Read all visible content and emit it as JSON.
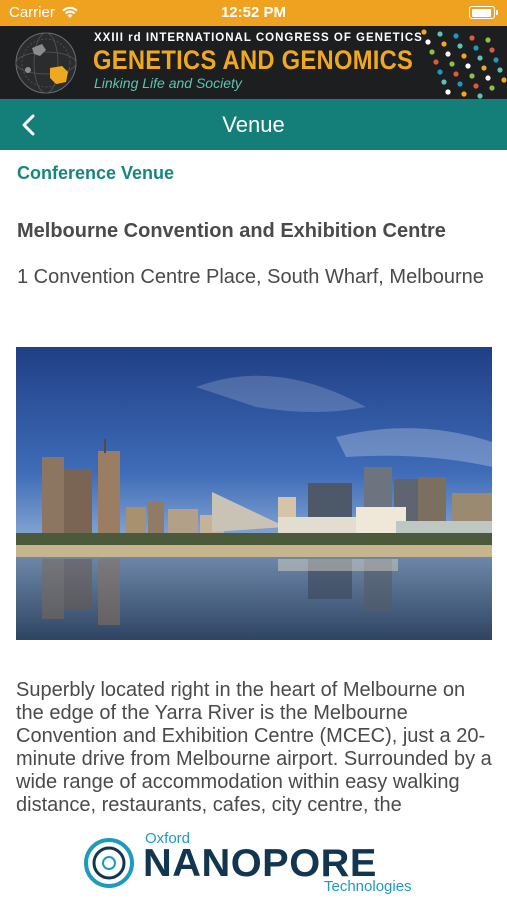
{
  "status_bar": {
    "carrier": "Carrier",
    "time": "12:52 PM",
    "battery_level": 0.95
  },
  "banner": {
    "congress_line": "XXIII rd INTERNATIONAL CONGRESS OF GENETICS",
    "title": "GENETICS AND GENOMICS",
    "subtitle": "Linking Life and Society",
    "accent_color": "#f0a821",
    "subtitle_color": "#5ec3b5"
  },
  "nav": {
    "title": "Venue",
    "back_icon": "chevron-left-icon",
    "background_color": "#147f78"
  },
  "content": {
    "section_heading": "Conference Venue",
    "venue_name": "Melbourne Convention and Exhibition Centre",
    "venue_address": "1 Convention Centre Place, South Wharf, Melbourne",
    "description": "Superbly located right in the heart of Melbourne on the edge of the Yarra River is the Melbourne Convention and Exhibition Centre (MCEC), just a 20-minute drive from Melbourne airport. Surrounded by a wide range of accommodation within easy walking distance, restaurants, cafes, city centre, the"
  },
  "footer": {
    "sponsor_top": "Oxford",
    "sponsor_name": "NANOPORE",
    "sponsor_bottom": "Technologies"
  }
}
